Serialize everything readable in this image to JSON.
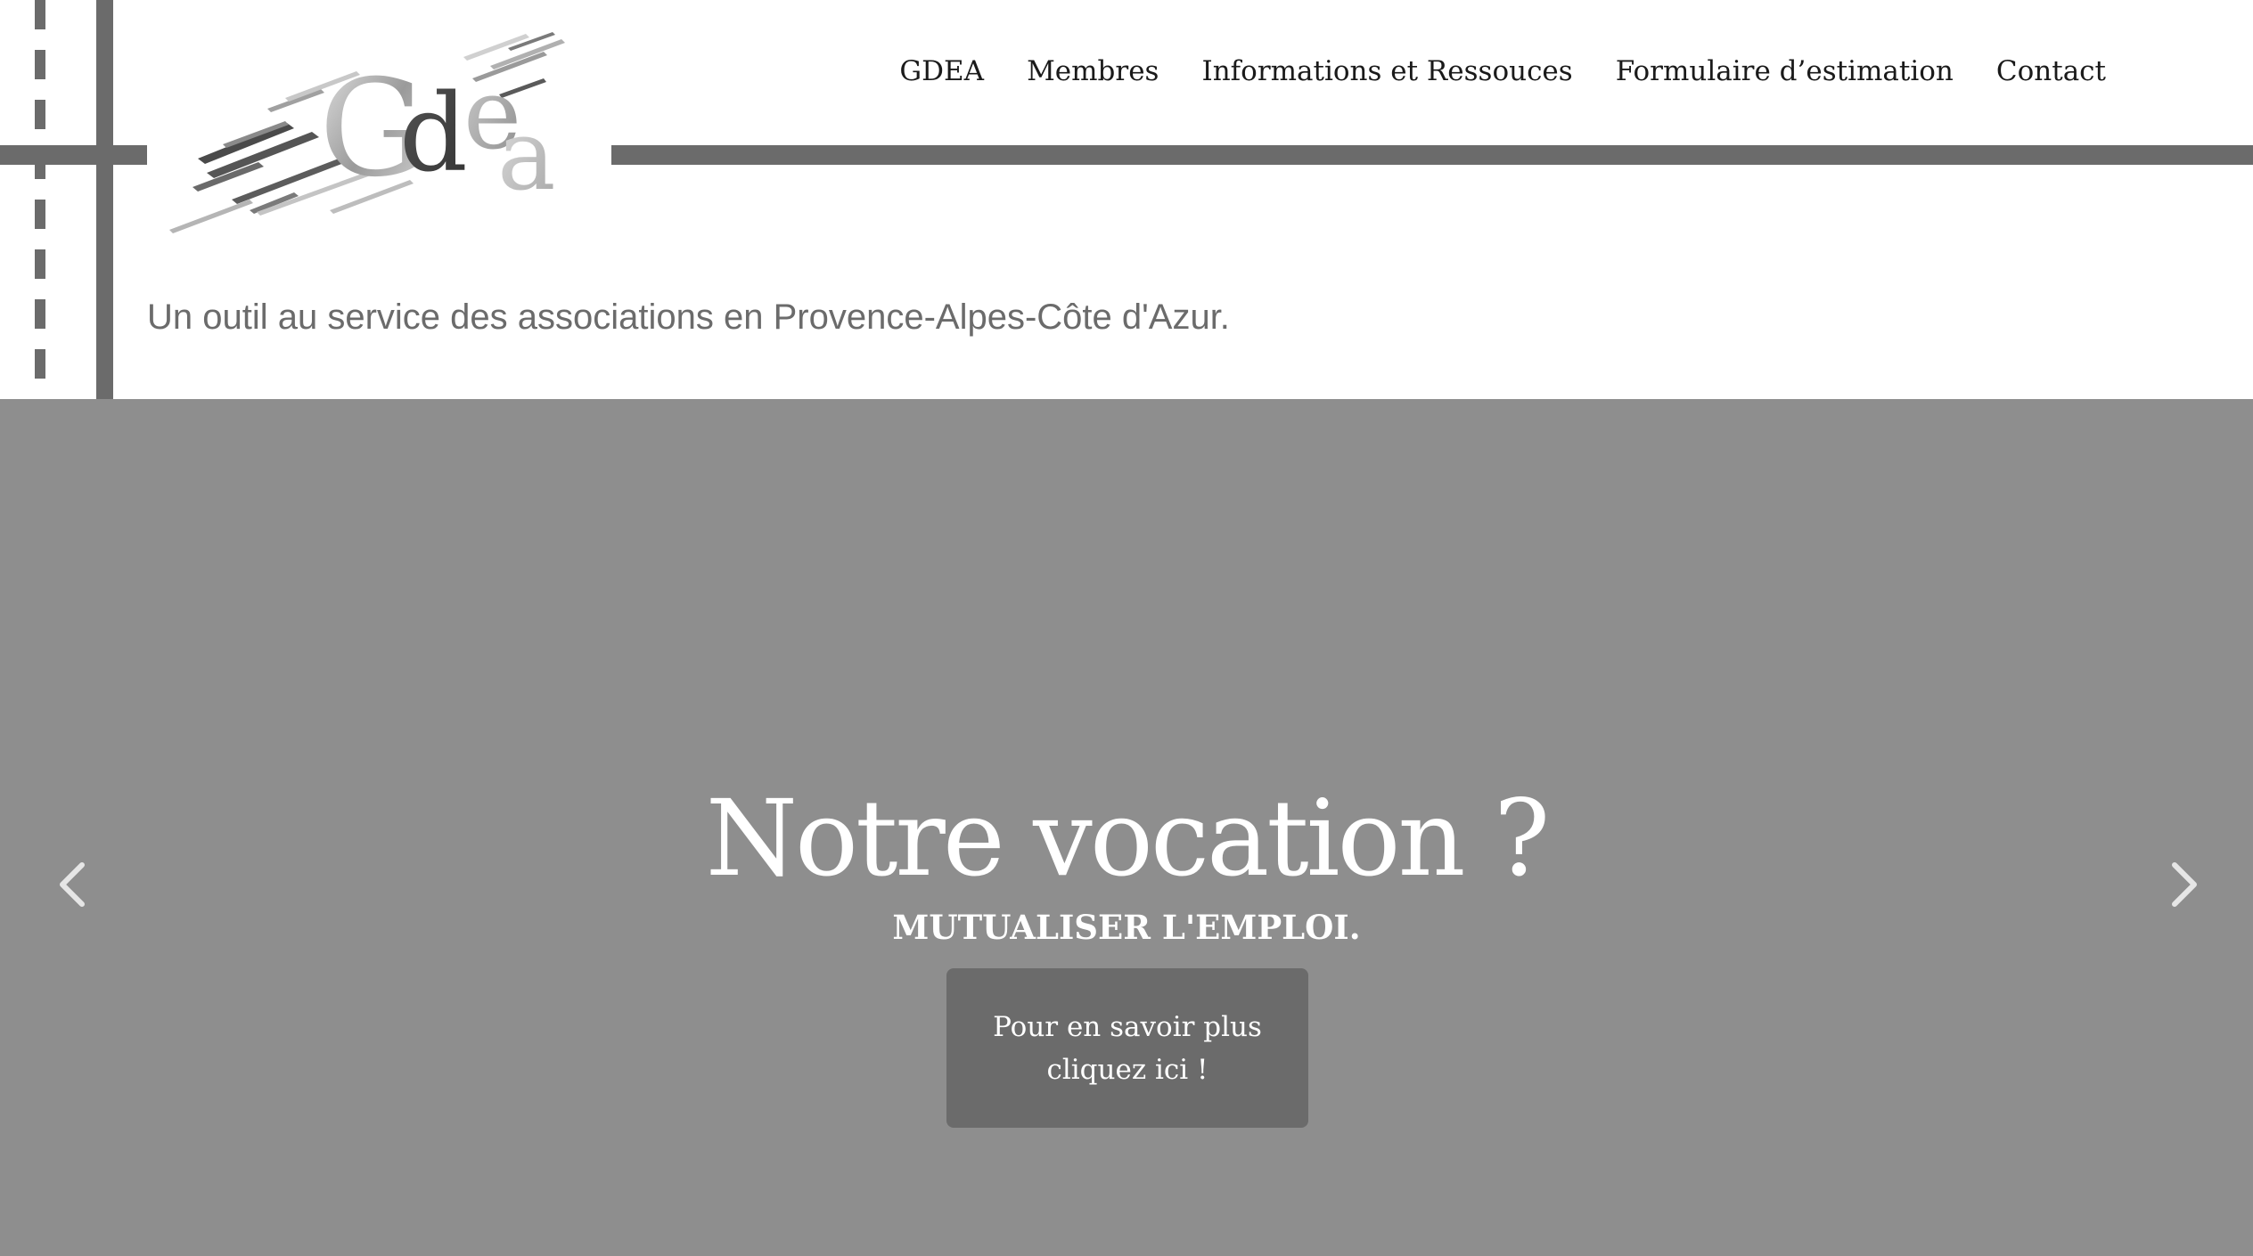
{
  "header": {
    "logo_text": "Gdea",
    "tagline": "Un outil au service des associations en Provence-Alpes-Côte d'Azur."
  },
  "nav": {
    "items": [
      {
        "label": "GDEA"
      },
      {
        "label": "Membres"
      },
      {
        "label": "Informations et Ressouces"
      },
      {
        "label": "Formulaire d’estimation"
      },
      {
        "label": "Contact"
      }
    ]
  },
  "hero": {
    "title": "Notre vocation ?",
    "subtitle": "MUTUALISER L'EMPLOI.",
    "button_label": "Pour en savoir plus cliquez ici !",
    "prev_icon": "chevron-left-icon",
    "next_icon": "chevron-right-icon"
  },
  "colors": {
    "hero_background": "#8e8e8e",
    "accent_gray": "#6b6b6b",
    "text_white": "#ffffff",
    "nav_text": "#1a1a1a",
    "tagline_text": "#6b6b6b"
  }
}
